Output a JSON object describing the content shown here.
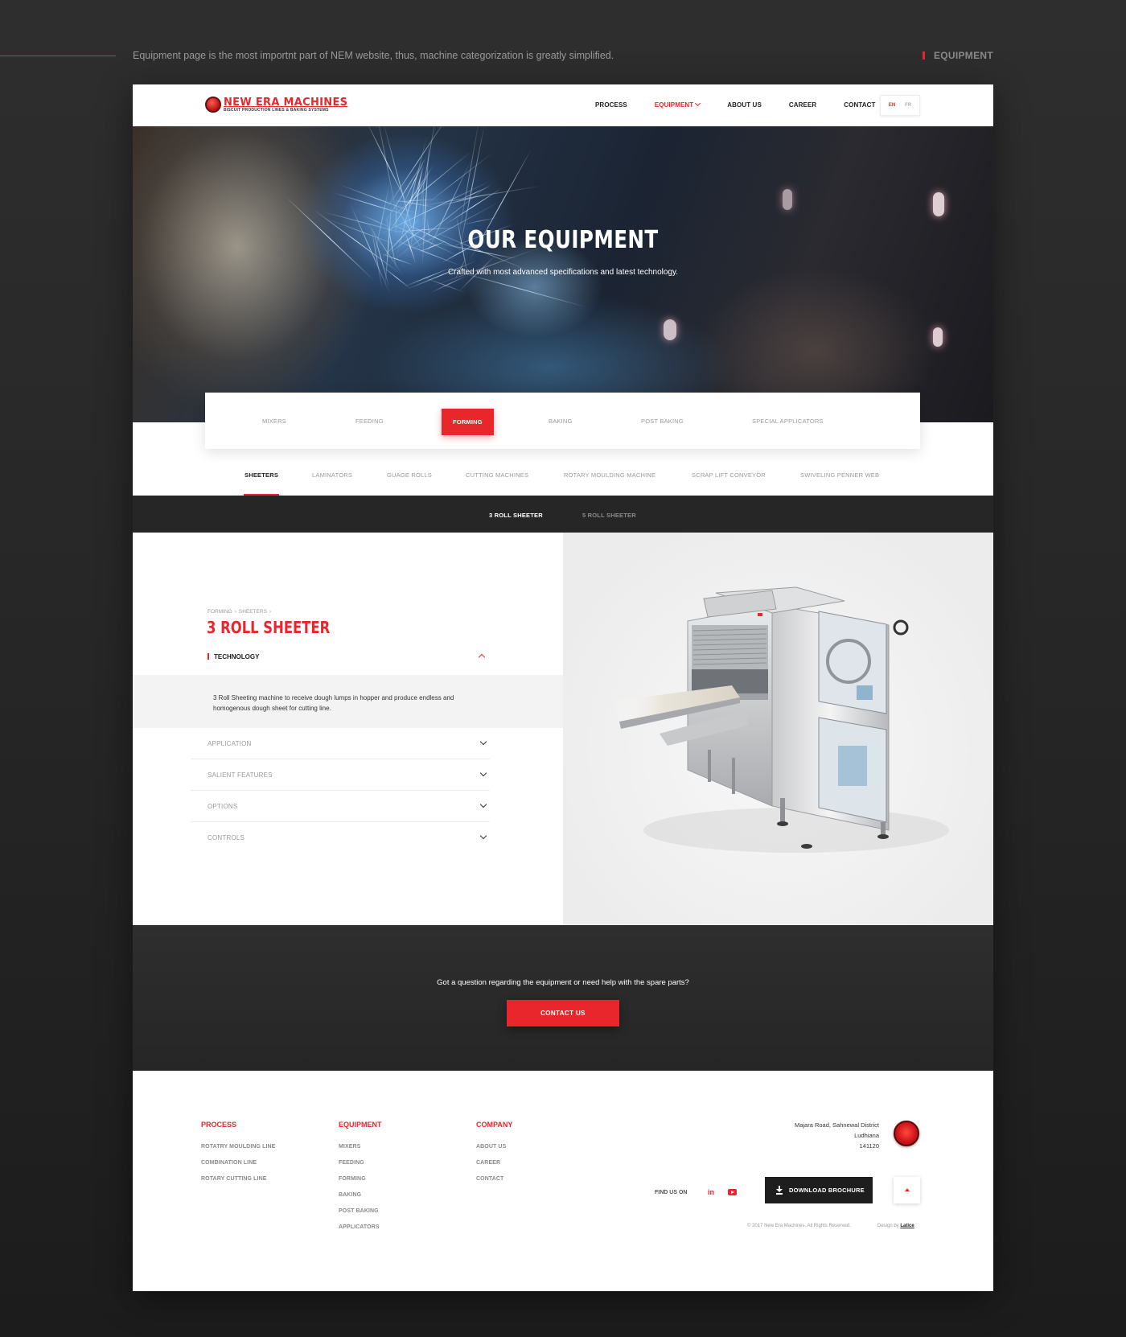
{
  "presentation": {
    "caption": "Equipment page is the most importnt part of NEM website, thus, machine categorization is greatly simplified.",
    "tag": "EQUIPMENT"
  },
  "logo": {
    "name": "NEW ERA MACHINES",
    "tagline": "BISCUIT PRODUCTION LINES & BAKING SYSTEMS"
  },
  "nav": {
    "items": [
      "PROCESS",
      "EQUIPMENT",
      "ABOUT US",
      "CAREER",
      "CONTACT"
    ],
    "active": "EQUIPMENT",
    "languages": [
      "EN",
      "FR"
    ],
    "active_language": "EN"
  },
  "hero": {
    "title": "OUR EQUIPMENT",
    "subtitle": "Crafted with most advanced specifications and latest technology."
  },
  "categories": {
    "items": [
      "MIXERS",
      "FEEDING",
      "FORMING",
      "BAKING",
      "POST BAKING",
      "SPECIAL APPLICATORS"
    ],
    "active": "FORMING"
  },
  "subcategories": {
    "items": [
      "SHEETERS",
      "LAMINATORS",
      "GUAGE ROLLS",
      "CUTTING MACHINES",
      "ROTARY MOULDING MACHINE",
      "SCRAP LIFT CONVEYOR",
      "SWIVELING PENNER WEB"
    ],
    "active": "SHEETERS"
  },
  "models": {
    "items": [
      "3 ROLL SHEETER",
      "5 ROLL SHEETER"
    ],
    "active": "3 ROLL SHEETER"
  },
  "product": {
    "breadcrumb": [
      "FORMING",
      "SHEETERS"
    ],
    "breadcrumb_sep": "›",
    "title": "3 ROLL SHEETER",
    "open_section": "TECHNOLOGY",
    "open_text": "3 Roll Sheeting machine to receive dough lumps in hopper and produce endless and homogenous dough sheet for cutting line.",
    "sections": [
      "APPLICATION",
      "SALIENT FEATURES",
      "OPTIONS",
      "CONTROLS"
    ]
  },
  "cta": {
    "question": "Got a question regarding the equipment or need help with the spare parts?",
    "button": "CONTACT US"
  },
  "footer": {
    "process": {
      "heading": "PROCESS",
      "links": [
        "ROTATRY MOULDING LINE",
        "COMBINATION LINE",
        "ROTARY CUTTING LINE"
      ]
    },
    "equipment": {
      "heading": "EQUIPMENT",
      "links": [
        "MIXERS",
        "FEEDING",
        "FORMING",
        "BAKING",
        "POST BAKING",
        "APPLICATORS"
      ]
    },
    "company": {
      "heading": "COMPANY",
      "links": [
        "ABOUT US",
        "CAREER",
        "CONTACT"
      ]
    },
    "address": [
      "Majara Road, Sahnewal District",
      "Ludhiana",
      "141120"
    ],
    "find_us": "FIND US ON",
    "social": [
      "in",
      "youtube"
    ],
    "download": "DOWNLOAD BROCHURE",
    "copyright": "© 2017 New Era Machines. All Rights Reserved.",
    "design_by_prefix": "Design by",
    "design_by": "Latice"
  },
  "colors": {
    "accent": "#e8262c",
    "dark": "#262626"
  },
  "icons": [
    "chevron-down-icon",
    "chevron-up-icon",
    "linkedin-icon",
    "youtube-icon",
    "download-icon",
    "back-to-top-icon"
  ]
}
